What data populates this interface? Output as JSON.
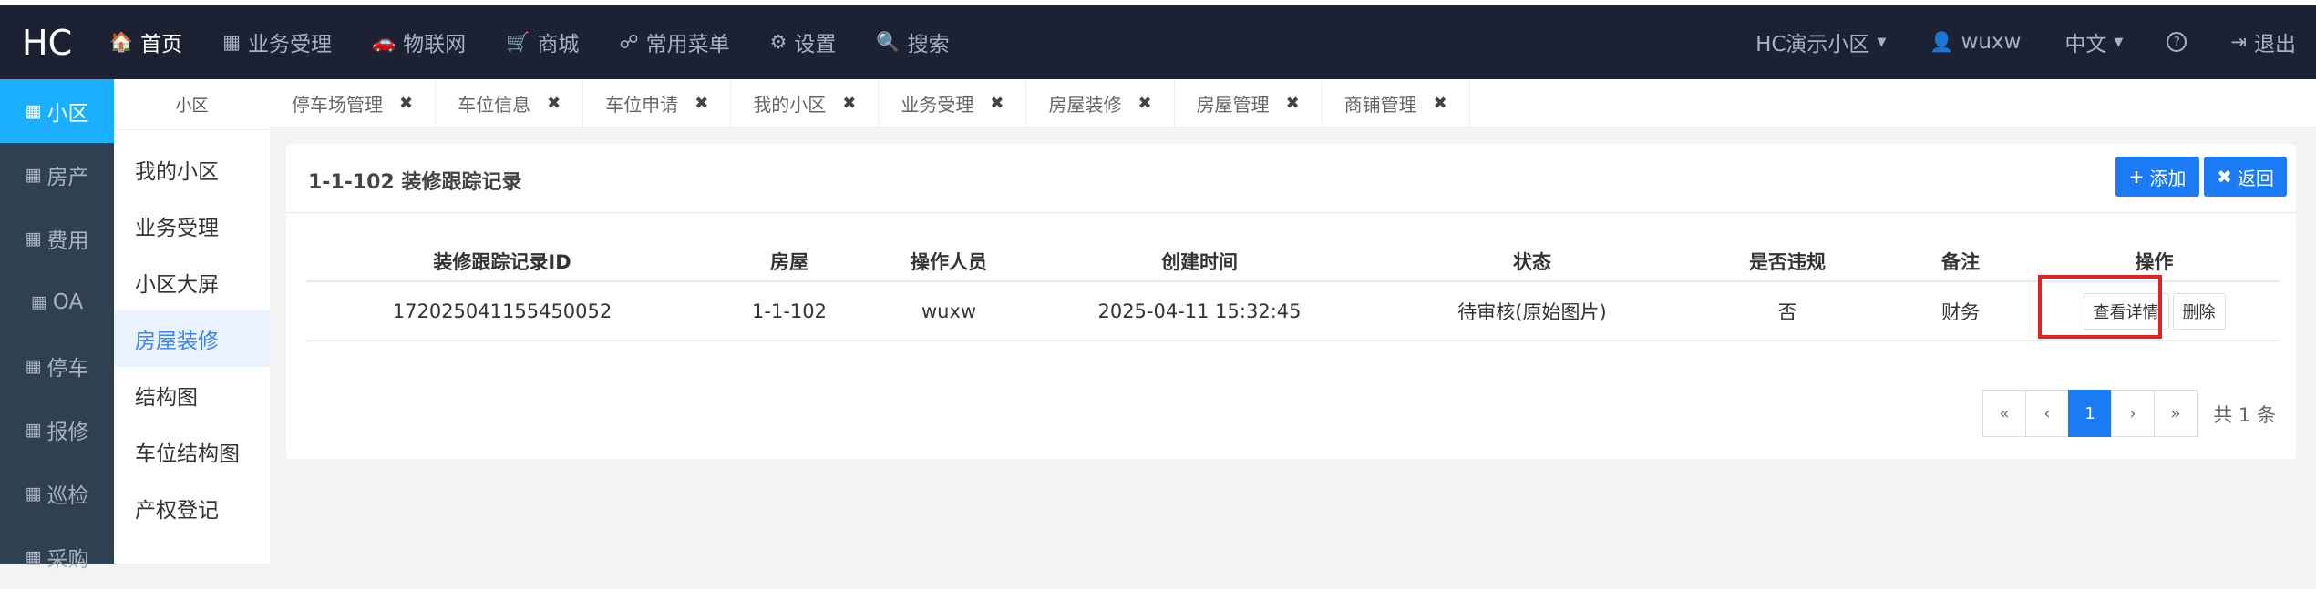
{
  "topbar": {
    "logo": "HC",
    "nav": [
      {
        "icon": "🏠",
        "label": "首页",
        "active": true
      },
      {
        "icon": "▦",
        "label": "业务受理"
      },
      {
        "icon": "🚗",
        "label": "物联网"
      },
      {
        "icon": "🛒",
        "label": "商城"
      },
      {
        "icon": "☍",
        "label": "常用菜单"
      },
      {
        "icon": "⚙",
        "label": "设置"
      },
      {
        "icon": "🔍",
        "label": "搜索"
      }
    ],
    "right": {
      "community": "HC演示小区",
      "user": "wuxw",
      "language": "中文",
      "help_icon": "?",
      "logout": "退出"
    }
  },
  "leftbar": {
    "items": [
      {
        "label": "小区",
        "active": true
      },
      {
        "label": "房产"
      },
      {
        "label": "费用"
      },
      {
        "label": "OA"
      },
      {
        "label": "停车"
      },
      {
        "label": "报修"
      },
      {
        "label": "巡检"
      },
      {
        "label": "采购"
      }
    ]
  },
  "subbar": {
    "header": "小区",
    "items": [
      {
        "label": "我的小区"
      },
      {
        "label": "业务受理"
      },
      {
        "label": "小区大屏"
      },
      {
        "label": "房屋装修",
        "active": true
      },
      {
        "label": "结构图"
      },
      {
        "label": "车位结构图"
      },
      {
        "label": "产权登记"
      }
    ]
  },
  "tabs": [
    "停车场管理",
    "车位信息",
    "车位申请",
    "我的小区",
    "业务受理",
    "房屋装修",
    "房屋管理",
    "商铺管理"
  ],
  "card": {
    "title": "1-1-102 装修跟踪记录",
    "add_label": "添加",
    "back_label": "返回"
  },
  "table": {
    "headers": [
      "装修跟踪记录ID",
      "房屋",
      "操作人员",
      "创建时间",
      "状态",
      "是否违规",
      "备注",
      "操作"
    ],
    "rows": [
      {
        "id": "172025041155450052",
        "room": "1-1-102",
        "operator": "wuxw",
        "created": "2025-04-11 15:32:45",
        "status": "待审核(原始图片)",
        "violation": "否",
        "remark": "财务",
        "view_label": "查看详情",
        "delete_label": "删除"
      }
    ]
  },
  "pagination": {
    "first": "«",
    "prev": "‹",
    "current": "1",
    "next": "›",
    "last": "»",
    "total": "共 1 条"
  },
  "colors": {
    "topbar": "#1c2233",
    "sidebar": "#2f4050",
    "accent": "#1a7bf4",
    "highlight": "#e32222"
  }
}
